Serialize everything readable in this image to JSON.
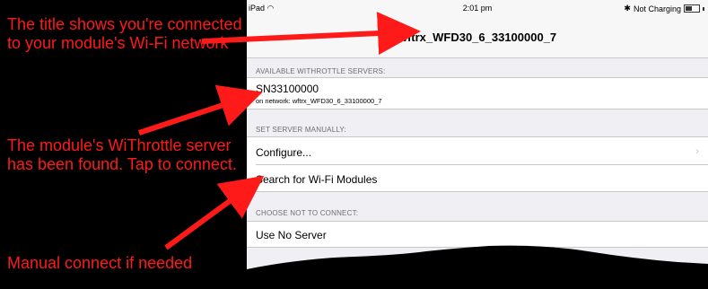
{
  "annotations": {
    "title_note": "The title shows you're connected to your module's Wi-Fi network",
    "found_note": "The module's WiThrottle server has been found. Tap to connect.",
    "manual_note": "Manual connect if needed",
    "color": "#ff1a1a"
  },
  "status_bar": {
    "device": "iPad",
    "wifi_icon": "wifi-icon",
    "time": "2:01 pm",
    "bluetooth_icon": "bluetooth-icon",
    "battery_status": "Not Charging",
    "battery_icon": "battery-icon"
  },
  "nav": {
    "title": "wftrx_WFD30_6_33100000_7"
  },
  "sections": {
    "available_header": "AVAILABLE WITHROTTLE SERVERS:",
    "manual_header": "SET SERVER MANUALLY:",
    "no_connect_header": "CHOOSE NOT TO CONNECT:"
  },
  "server": {
    "name": "SN33100000",
    "network": "on network: wftrx_WFD30_6_33100000_7"
  },
  "manual": {
    "configure_label": "Configure...",
    "search_label": "Search for Wi-Fi Modules"
  },
  "no_connect": {
    "use_no_server_label": "Use No Server"
  }
}
